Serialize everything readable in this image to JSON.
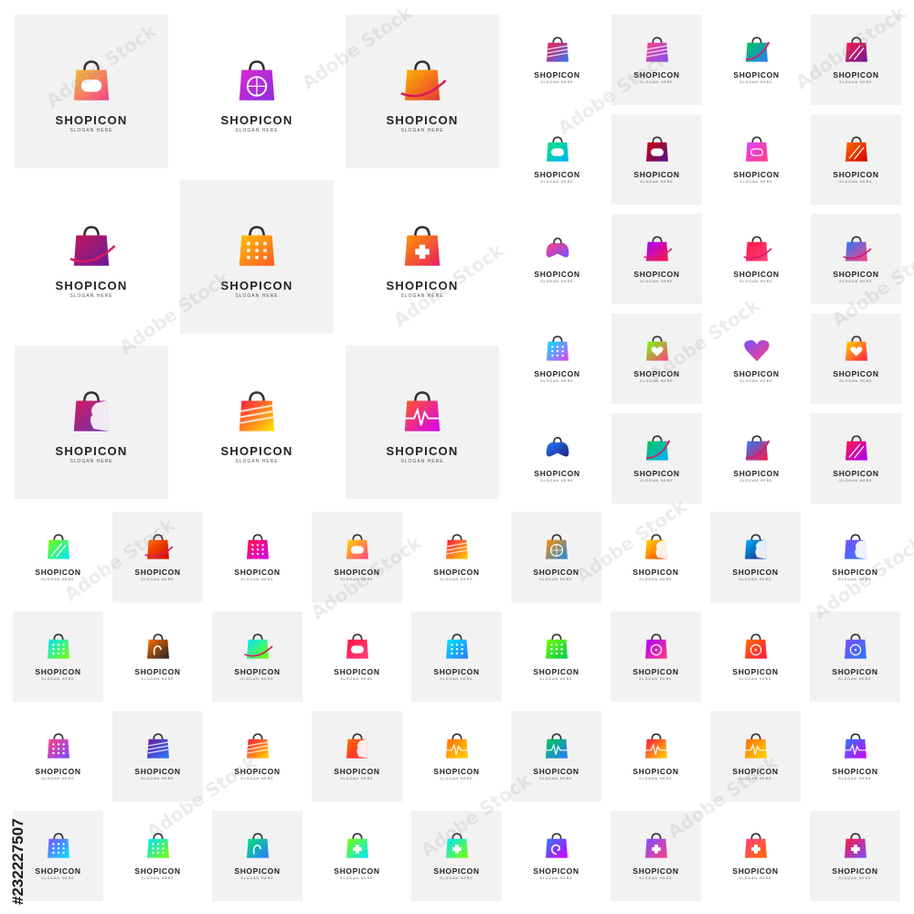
{
  "brand_name": "SHOPICON",
  "slogan": "SLOGAN HERE",
  "stock_id": "#232227507",
  "watermark_text": "Adobe Stock",
  "palette": [
    "#f9c22e",
    "#f0438f",
    "#8e44ad",
    "#ff6b35",
    "#3ec1d3",
    "#2ecc71",
    "#e74c3c",
    "#6a5acd",
    "#1e88e5"
  ],
  "big_tiles": [
    {
      "icon": "bag-gamepad-icon",
      "colors": [
        "#f9c22e",
        "#f0438f"
      ]
    },
    {
      "icon": "bag-heart-wheel-icon",
      "colors": [
        "#d62ad0",
        "#8e2de2"
      ]
    },
    {
      "icon": "bag-shoe-icon",
      "colors": [
        "#ffb300",
        "#e53935"
      ]
    },
    {
      "icon": "bag-arrow-swoosh-icon",
      "colors": [
        "#c2185b",
        "#6a1b9a"
      ]
    },
    {
      "icon": "bag-pixel-dots-icon",
      "colors": [
        "#ffc107",
        "#ff5722"
      ]
    },
    {
      "icon": "bag-medical-cross-icon",
      "colors": [
        "#ff9800",
        "#e91e63"
      ]
    },
    {
      "icon": "bag-face-profile-icon",
      "colors": [
        "#d81b60",
        "#5e35b1"
      ]
    },
    {
      "icon": "bag-rainbow-stripes-icon",
      "colors": [
        "#ff1744",
        "#ffea00"
      ]
    },
    {
      "icon": "bag-pulse-line-icon",
      "colors": [
        "#ff5722",
        "#d500f9"
      ]
    }
  ],
  "small_tiles": [
    {
      "icon": "bag-stripes-icon",
      "colors": [
        "#ff1744",
        "#2979ff"
      ]
    },
    {
      "icon": "bag-diagonal-icon",
      "colors": [
        "#ff4081",
        "#7c4dff"
      ]
    },
    {
      "icon": "bag-plane-icon",
      "colors": [
        "#00c853",
        "#2979ff"
      ]
    },
    {
      "icon": "bag-speed-icon",
      "colors": [
        "#ff1744",
        "#6a1b9a"
      ]
    },
    {
      "icon": "bag-gamepad-icon",
      "colors": [
        "#00e676",
        "#00b0ff"
      ]
    },
    {
      "icon": "bag-gamepad-icon",
      "colors": [
        "#d50000",
        "#4a148c"
      ]
    },
    {
      "icon": "bag-gamepad-outline-icon",
      "colors": [
        "#e040fb",
        "#ff4081"
      ]
    },
    {
      "icon": "bag-slash-icon",
      "colors": [
        "#ff6d00",
        "#d50000"
      ]
    },
    {
      "icon": "gamepad-icon",
      "colors": [
        "#ff4081",
        "#7c4dff"
      ]
    },
    {
      "icon": "bag-shoe-icon",
      "colors": [
        "#aa00ff",
        "#ff1744"
      ]
    },
    {
      "icon": "bag-orbit-icon",
      "colors": [
        "#ff1744",
        "#ff4081"
      ]
    },
    {
      "icon": "bag-shoe-icon",
      "colors": [
        "#2979ff",
        "#ff4081"
      ]
    },
    {
      "icon": "bag-dots-icon",
      "colors": [
        "#00e5ff",
        "#e040fb"
      ]
    },
    {
      "icon": "bag-heart-icon",
      "colors": [
        "#76ff03",
        "#ff4081"
      ]
    },
    {
      "icon": "heart-icon",
      "colors": [
        "#7c4dff",
        "#ff4081"
      ]
    },
    {
      "icon": "bag-heart-icon",
      "colors": [
        "#ffd600",
        "#ff1744"
      ]
    },
    {
      "icon": "gamepad-icon",
      "colors": [
        "#2979ff",
        "#1a237e"
      ]
    },
    {
      "icon": "bag-arrow-icon",
      "colors": [
        "#00c853",
        "#00b0ff"
      ]
    },
    {
      "icon": "bag-plane-icon",
      "colors": [
        "#2979ff",
        "#ff1744"
      ]
    },
    {
      "icon": "bag-slash-icon",
      "colors": [
        "#ff1744",
        "#aa00ff"
      ]
    },
    {
      "icon": "bag-speed-icon",
      "colors": [
        "#76ff03",
        "#00e5ff"
      ]
    },
    {
      "icon": "bag-swoosh-icon",
      "colors": [
        "#ff6d00",
        "#d50000"
      ]
    },
    {
      "icon": "bag-pixel-dots-icon",
      "colors": [
        "#ff1744",
        "#d500f9"
      ]
    },
    {
      "icon": "bag-gamepad-icon",
      "colors": [
        "#ffd600",
        "#ff4081"
      ]
    },
    {
      "icon": "bag-rainbow-stripes-icon",
      "colors": [
        "#ff1744",
        "#ffd600"
      ]
    },
    {
      "icon": "bag-heart-wheel-icon",
      "colors": [
        "#ff9100",
        "#1e88e5"
      ]
    },
    {
      "icon": "bag-face-profile-icon",
      "colors": [
        "#ffd600",
        "#ff3d00"
      ]
    },
    {
      "icon": "bag-face-profile-icon",
      "colors": [
        "#00b0ff",
        "#1a237e"
      ]
    },
    {
      "icon": "bag-face-icon",
      "colors": [
        "#7c4dff",
        "#2979ff"
      ]
    },
    {
      "icon": "bag-dots-icon",
      "colors": [
        "#00e5ff",
        "#76ff03"
      ]
    },
    {
      "icon": "bag-hand-icon",
      "colors": [
        "#ff6d00",
        "#212121"
      ]
    },
    {
      "icon": "bag-swoosh-icon",
      "colors": [
        "#00e5ff",
        "#76ff03"
      ]
    },
    {
      "icon": "bag-gamepad-icon",
      "colors": [
        "#ff1744",
        "#ff4081"
      ]
    },
    {
      "icon": "bag-pixel-dots-icon",
      "colors": [
        "#00e5ff",
        "#2979ff"
      ]
    },
    {
      "icon": "bag-pixel-dots-icon",
      "colors": [
        "#76ff03",
        "#00c853"
      ]
    },
    {
      "icon": "bag-film-reel-icon",
      "colors": [
        "#aa00ff",
        "#ff4081"
      ]
    },
    {
      "icon": "bag-film-reel-icon",
      "colors": [
        "#ff6d00",
        "#ff1744"
      ]
    },
    {
      "icon": "bag-film-reel-icon",
      "colors": [
        "#7c4dff",
        "#2979ff"
      ]
    },
    {
      "icon": "bag-dots-icon",
      "colors": [
        "#ff4081",
        "#7c4dff"
      ]
    },
    {
      "icon": "bag-stripes-icon",
      "colors": [
        "#6a1b9a",
        "#2979ff"
      ]
    },
    {
      "icon": "bag-rainbow-stripes-icon",
      "colors": [
        "#ff1744",
        "#ffd600"
      ]
    },
    {
      "icon": "bag-face-icon",
      "colors": [
        "#ff6d00",
        "#ff1744"
      ]
    },
    {
      "icon": "bag-pulse-line-icon",
      "colors": [
        "#ff6d00",
        "#ffd600"
      ]
    },
    {
      "icon": "bag-pulse-line-icon",
      "colors": [
        "#00c853",
        "#2979ff"
      ]
    },
    {
      "icon": "bag-pulse-line-icon",
      "colors": [
        "#ff1744",
        "#ffd600"
      ]
    },
    {
      "icon": "bag-pulse-line-icon",
      "colors": [
        "#ff6d00",
        "#ffd600"
      ]
    },
    {
      "icon": "bag-pulse-line-icon",
      "colors": [
        "#2979ff",
        "#d500f9"
      ]
    },
    {
      "icon": "bag-pixel-dots-icon",
      "colors": [
        "#7c4dff",
        "#00e5ff"
      ]
    },
    {
      "icon": "bag-pixel-dots-icon",
      "colors": [
        "#00e5ff",
        "#76ff03"
      ]
    },
    {
      "icon": "bag-hand-icon",
      "colors": [
        "#00e676",
        "#2979ff"
      ]
    },
    {
      "icon": "bag-medical-cross-icon",
      "colors": [
        "#76ff03",
        "#00e5ff"
      ]
    },
    {
      "icon": "bag-medical-cross-icon",
      "colors": [
        "#00e5ff",
        "#76ff03"
      ]
    },
    {
      "icon": "bag-swirl-icon",
      "colors": [
        "#2979ff",
        "#d500f9"
      ]
    },
    {
      "icon": "bag-medical-cross-icon",
      "colors": [
        "#7c4dff",
        "#ff4081"
      ]
    },
    {
      "icon": "bag-medical-cross-icon",
      "colors": [
        "#ff4081",
        "#ff6d00"
      ]
    },
    {
      "icon": "bag-medical-cross-icon",
      "colors": [
        "#ff1744",
        "#7c4dff"
      ]
    }
  ]
}
